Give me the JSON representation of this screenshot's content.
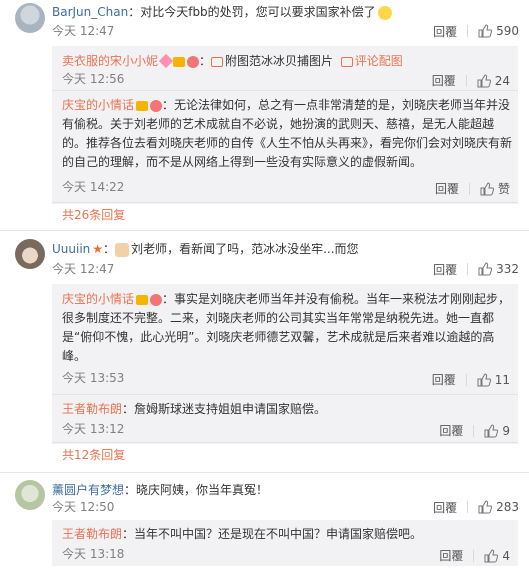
{
  "comments": [
    {
      "user": "BarJun_Chan",
      "text": "：对比今天fbb的处罚，您可以要求国家补偿了",
      "time": "今天 12:47",
      "reply_label": "回覆",
      "likes": "590",
      "replies": [
        {
          "user": "卖衣服的宋小小妮",
          "link_text": "附图范冰冰贝捕图片",
          "link2_text": "评论配图",
          "time": "今天 12:56",
          "reply_label": "回覆",
          "likes": "24"
        },
        {
          "user": "庆宝的小情话",
          "text": "：无论法律如何，总之有一点非常清楚的是，刘晓庆老师当年并没有偷税。关于刘老师的艺术成就自不必说，她扮演的武则天、慈禧，是无人能超越的。推荐各位去看刘晓庆老师的自传《人生不怕从头再来》，看完你们会对刘晓庆有新的自己的理解，而不是从网络上得到一些没有实际意义的虚假新闻。",
          "time": "今天 14:22",
          "reply_label": "回覆",
          "likes": "赞"
        }
      ],
      "more": "共26条回复"
    },
    {
      "user": "Uuuiin",
      "text": "刘老师，看新闻了吗，范冰冰没坐牢...而您",
      "time": "今天 12:47",
      "reply_label": "回覆",
      "likes": "332",
      "replies": [
        {
          "user": "庆宝的小情话",
          "text": "：事实是刘晓庆老师当年并没有偷税。当年一来税法才刚刚起步，很多制度还不完整。二来，刘晓庆老师的公司其实当年常常是纳税先进。她一直都是“俯仰不愧，此心光明”。刘晓庆老师德艺双馨，艺术成就是后来者难以逾越的高峰。",
          "time": "今天 13:53",
          "reply_label": "回覆",
          "likes": "11"
        },
        {
          "user": "王者勒布朗",
          "text": "：詹姆斯球迷支持姐姐申请国家赔偿。",
          "time": "今天 13:12",
          "reply_label": "回覆",
          "likes": "9"
        }
      ],
      "more": "共12条回复"
    },
    {
      "user": "薰圆户有梦想",
      "text": "：晓庆阿姨，你当年真冤！",
      "time": "今天 12:50",
      "reply_label": "回覆",
      "likes": "283",
      "replies": [
        {
          "user": "王者勒布朗",
          "text": "：当年不叫中国？还是现在不叫中国？申请国家赔偿吧。",
          "time": "今天 13:18",
          "reply_label": "回覆",
          "likes": "4"
        }
      ]
    }
  ],
  "colors": {
    "link": "#eb7350",
    "time": "#808080",
    "reply_bg": "#f2f2f5"
  },
  "icons": [
    "thumb-up-icon",
    "crown-icon",
    "vip-icon",
    "heart-icon",
    "emoji-icon",
    "picture-icon"
  ]
}
